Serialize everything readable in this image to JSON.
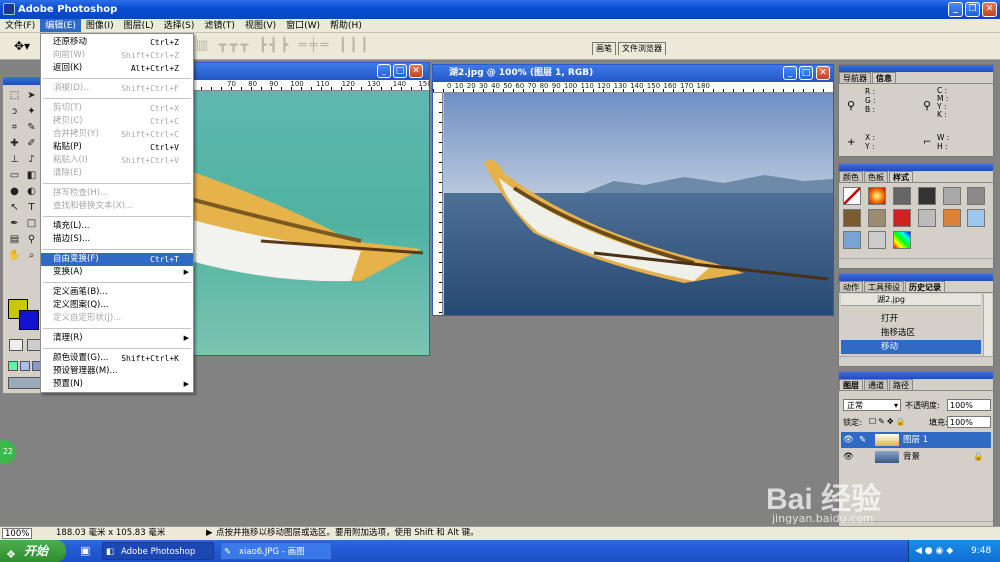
{
  "app": {
    "title": "Adobe Photoshop"
  },
  "menubar": {
    "items": [
      "文件(F)",
      "编辑(E)",
      "图像(I)",
      "图层(L)",
      "选择(S)",
      "滤镜(T)",
      "视图(V)",
      "窗口(W)",
      "帮助(H)"
    ]
  },
  "options": {
    "palette_tabs": [
      "画笔",
      "文件浏览器"
    ]
  },
  "edit_menu": {
    "items": [
      {
        "label": "还原移动",
        "shortcut": "Ctrl+Z"
      },
      {
        "label": "向前(W)",
        "shortcut": "Shift+Ctrl+Z"
      },
      {
        "label": "返回(K)",
        "shortcut": "Alt+Ctrl+Z"
      },
      {
        "label": "消褪(D)...",
        "shortcut": "Shift+Ctrl+F"
      },
      {
        "label": "剪切(T)",
        "shortcut": "Ctrl+X"
      },
      {
        "label": "拷贝(C)",
        "shortcut": "Ctrl+C"
      },
      {
        "label": "合并拷贝(Y)",
        "shortcut": "Shift+Ctrl+C"
      },
      {
        "label": "粘贴(P)",
        "shortcut": "Ctrl+V"
      },
      {
        "label": "粘贴入(I)",
        "shortcut": "Shift+Ctrl+V"
      },
      {
        "label": "清除(E)",
        "shortcut": ""
      },
      {
        "label": "拼写检查(H)...",
        "shortcut": ""
      },
      {
        "label": "查找和替换文本(X)...",
        "shortcut": ""
      },
      {
        "label": "填充(L)...",
        "shortcut": ""
      },
      {
        "label": "描边(S)...",
        "shortcut": ""
      },
      {
        "label": "自由变换(F)",
        "shortcut": "Ctrl+T"
      },
      {
        "label": "变换(A)",
        "shortcut": ""
      },
      {
        "label": "定义画笔(B)...",
        "shortcut": ""
      },
      {
        "label": "定义图案(Q)...",
        "shortcut": ""
      },
      {
        "label": "定义自定形状(J)...",
        "shortcut": ""
      },
      {
        "label": "清理(R)",
        "shortcut": ""
      },
      {
        "label": "颜色设置(G)...",
        "shortcut": "Shift+Ctrl+K"
      },
      {
        "label": "预设管理器(M)...",
        "shortcut": ""
      },
      {
        "label": "预置(N)",
        "shortcut": ""
      }
    ]
  },
  "doc1": {
    "ruler": "70 80 90 100 110 120 130 140 150 160"
  },
  "doc2": {
    "title": "湖2.jpg @ 100% (图层 1, RGB)",
    "ruler": "0  10  20  30  40  50  60  70  80  90  100  110  120  130  140  150  160  170  180",
    "corner": "01-02"
  },
  "navigator": {
    "tabs": [
      "导航器",
      "信息"
    ],
    "rgb": "R :\nG :\nB :",
    "cmyk": "C :\nM :\nY :\nK :",
    "xy": "X :\nY :",
    "wh": "W :\nH :"
  },
  "color_panel": {
    "tabs": [
      "颜色",
      "色板",
      "样式"
    ],
    "colors": {
      "accent": "#cc2222"
    }
  },
  "history_panel": {
    "tabs": [
      "动作",
      "工具预设",
      "历史记录"
    ],
    "snapshot": "湖2.jpg",
    "steps": [
      "打开",
      "拖移选区",
      "移动"
    ]
  },
  "layers_panel": {
    "tabs": [
      "图层",
      "通道",
      "路径"
    ],
    "blend_mode": "正常",
    "opacity_label": "不透明度:",
    "opacity": "100%",
    "lock_label": "锁定:",
    "fill_label": "填充:",
    "fill": "100%",
    "layers": [
      "图层 1",
      "背景"
    ]
  },
  "status": {
    "zoom": "100%",
    "doc_size": "188.03 毫米 x 105.83 毫米",
    "hint": "点按并拖移以移动图层或选区。要用附加选项，使用 Shift 和 Alt 键。"
  },
  "taskbar": {
    "start": "开始",
    "tasks": [
      "Adobe Photoshop",
      "xiao6.JPG - 画图"
    ],
    "clock": "9:48"
  },
  "watermark": {
    "text": "Bai 经验",
    "url": "jingyan.baidu.com"
  },
  "badge": "22"
}
